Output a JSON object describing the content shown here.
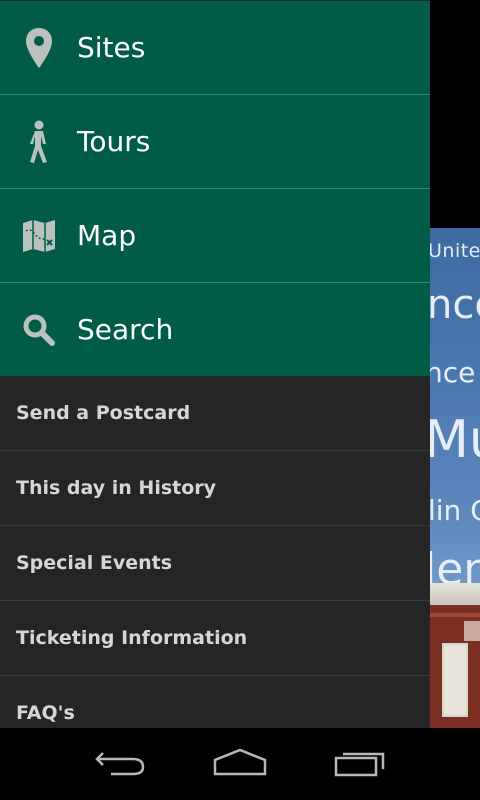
{
  "drawer": {
    "primary_items": [
      {
        "label": "Sites",
        "icon": "map-pin-icon"
      },
      {
        "label": "Tours",
        "icon": "walking-person-icon"
      },
      {
        "label": "Map",
        "icon": "folded-map-icon"
      },
      {
        "label": "Search",
        "icon": "search-icon"
      }
    ],
    "secondary_items": [
      {
        "label": "Send a Postcard"
      },
      {
        "label": "This day in History"
      },
      {
        "label": "Special Events"
      },
      {
        "label": "Ticketing Information"
      },
      {
        "label": "FAQ's"
      }
    ]
  },
  "background": {
    "lines": [
      "Unitec",
      "ncc",
      "nce",
      "Mu",
      "lin C",
      "len"
    ]
  },
  "navbar": {
    "buttons": [
      {
        "icon": "back-icon"
      },
      {
        "icon": "home-icon"
      },
      {
        "icon": "recent-apps-icon"
      }
    ]
  },
  "colors": {
    "primary_bg": "#015c47",
    "secondary_bg": "#252525",
    "accent_text": "#ffffff",
    "secondary_text": "#d6d6d6"
  }
}
